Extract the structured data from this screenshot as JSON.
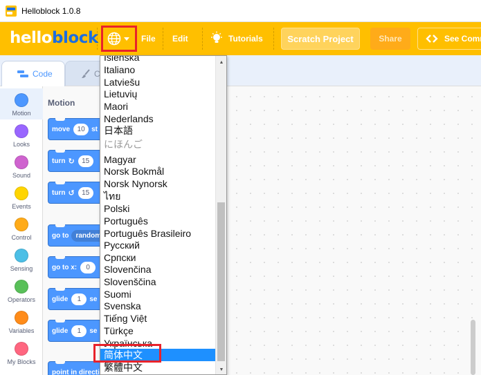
{
  "window": {
    "title": "Helloblock 1.0.8"
  },
  "menubar": {
    "logo_part1": "hello",
    "logo_part2": "block",
    "file_label": "File",
    "edit_label": "Edit",
    "tutorials_label": "Tutorials",
    "project_title": "Scratch Project",
    "share_label": "Share",
    "community_label": "See Comm"
  },
  "tabs": {
    "code_label": "Code",
    "costumes_label": "Co"
  },
  "categories": [
    {
      "label": "Motion",
      "color": "#4c97ff"
    },
    {
      "label": "Looks",
      "color": "#9966ff"
    },
    {
      "label": "Sound",
      "color": "#cf63cf"
    },
    {
      "label": "Events",
      "color": "#ffd500"
    },
    {
      "label": "Control",
      "color": "#ffab19"
    },
    {
      "label": "Sensing",
      "color": "#4cbfe6"
    },
    {
      "label": "Operators",
      "color": "#59c059"
    },
    {
      "label": "Variables",
      "color": "#ff8c1a"
    },
    {
      "label": "My Blocks",
      "color": "#ff6680"
    }
  ],
  "palette": {
    "title": "Motion",
    "blocks": {
      "move": {
        "text": "move",
        "value": "10",
        "trail": "st"
      },
      "turn_right": {
        "text": "turn",
        "arrow": "↻",
        "value": "15"
      },
      "turn_left": {
        "text": "turn",
        "arrow": "↺",
        "value": "15"
      },
      "goto": {
        "text": "go to",
        "value": "random"
      },
      "gotoxy": {
        "text": "go to x:",
        "value": "0"
      },
      "glide1": {
        "text": "glide",
        "value": "1",
        "trail": "se"
      },
      "glide2": {
        "text": "glide",
        "value": "1",
        "trail": "se"
      },
      "point": {
        "text": "point in directio"
      }
    }
  },
  "language_menu": {
    "items": [
      "Íslenska",
      "Italiano",
      "Latviešu",
      "Lietuvių",
      "Maori",
      "Nederlands",
      "日本語",
      "にほんご",
      "Magyar",
      "Norsk Bokmål",
      "Norsk Nynorsk",
      "ไทย",
      "Polski",
      "Português",
      "Português Brasileiro",
      "Русский",
      "Српски",
      "Slovenčina",
      "Slovenščina",
      "Suomi",
      "Svenska",
      "Tiếng Việt",
      "Türkçe",
      "Українська",
      "简体中文",
      "繁體中文"
    ],
    "selected": "简体中文",
    "dimmed": "にほんご",
    "selected_color": "#1e90ff"
  },
  "colors": {
    "menubar": "#ffbf00",
    "highlight_box": "#e8222b",
    "motion": "#4c97ff"
  }
}
